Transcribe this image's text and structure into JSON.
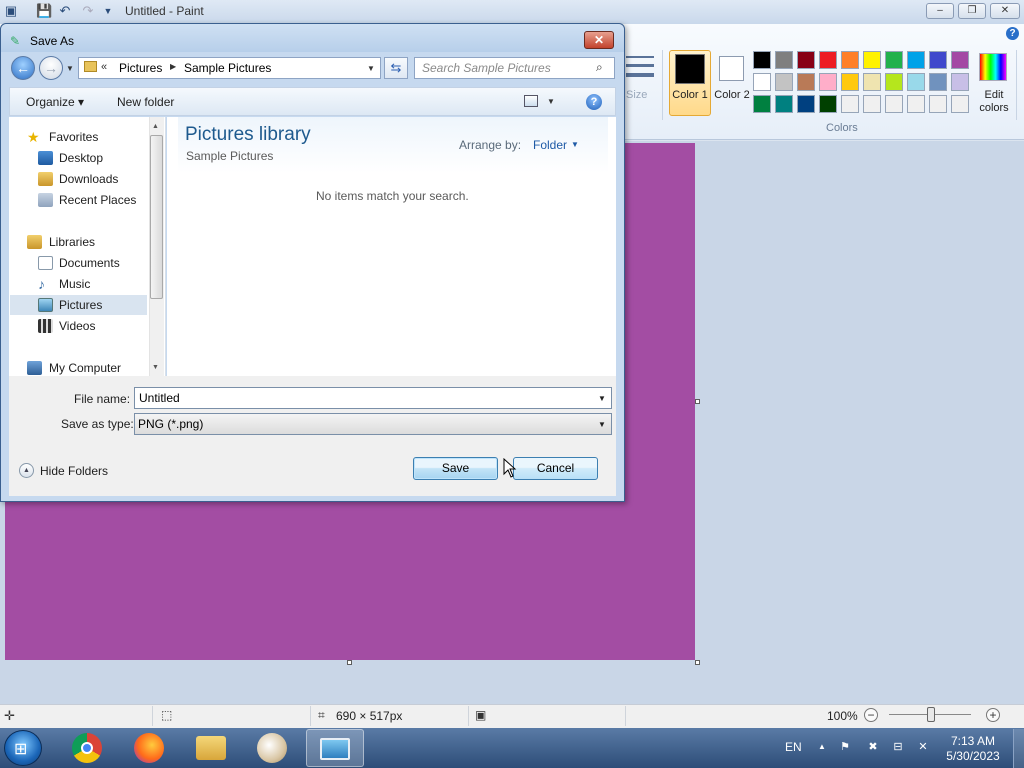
{
  "paint": {
    "title": "Untitled - Paint",
    "ribbon": {
      "size_label": "Size",
      "color1_label": "Color 1",
      "color2_label": "Color 2",
      "edit_colors_label": "Edit colors",
      "colors_group_label": "Colors",
      "color1": "#000000",
      "color2": "#ffffff",
      "palette_row1": [
        "#000000",
        "#7f7f7f",
        "#880015",
        "#ed1c24",
        "#ff7f27",
        "#fff200",
        "#22b14c",
        "#00a2e8",
        "#3f48cc",
        "#a349a4"
      ],
      "palette_row2": [
        "#ffffff",
        "#c3c3c3",
        "#b97a57",
        "#ffaec9",
        "#ffc90e",
        "#efe4b0",
        "#b5e61d",
        "#99d9ea",
        "#7092be",
        "#c8bfe7"
      ],
      "palette_row3": [
        "#008040",
        "#008080",
        "#004080",
        "#004000",
        "#f0f0f0",
        "#f0f0f0",
        "#f0f0f0",
        "#f0f0f0",
        "#f0f0f0",
        "#f0f0f0"
      ]
    },
    "canvas_color": "#a34da3",
    "status": {
      "dimensions": "690 × 517px",
      "zoom": "100%"
    }
  },
  "dialog": {
    "title": "Save As",
    "breadcrumb": [
      "Pictures",
      "Sample Pictures"
    ],
    "breadcrumb_more": "«",
    "search_placeholder": "Search Sample Pictures",
    "organize_label": "Organize ▾",
    "new_folder_label": "New folder",
    "nav": {
      "favorites": "Favorites",
      "desktop": "Desktop",
      "downloads": "Downloads",
      "recent_places": "Recent Places",
      "libraries": "Libraries",
      "documents": "Documents",
      "music": "Music",
      "pictures": "Pictures",
      "videos": "Videos",
      "my_computer": "My Computer"
    },
    "library_title": "Pictures library",
    "library_subtitle": "Sample Pictures",
    "arrange_label": "Arrange by:",
    "arrange_value": "Folder",
    "empty_message": "No items match your search.",
    "file_name_label": "File name:",
    "file_name_value": "Untitled",
    "save_type_label": "Save as type:",
    "save_type_value": "PNG (*.png)",
    "hide_folders_label": "Hide Folders",
    "save_button": "Save",
    "cancel_button": "Cancel"
  },
  "taskbar": {
    "language": "EN",
    "time": "7:13 AM",
    "date": "5/30/2023"
  }
}
